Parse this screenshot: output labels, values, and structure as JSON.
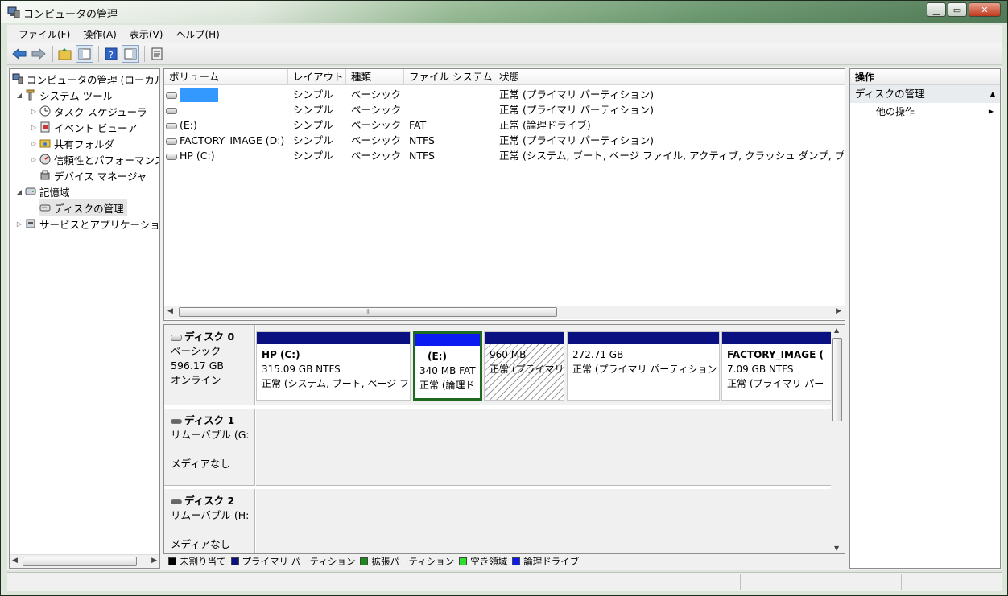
{
  "window": {
    "title": "コンピュータの管理"
  },
  "menu": [
    "ファイル(F)",
    "操作(A)",
    "表示(V)",
    "ヘルプ(H)"
  ],
  "tree": {
    "items": [
      {
        "label": "コンピュータの管理 (ローカル",
        "level": 0,
        "expander": ""
      },
      {
        "label": "システム ツール",
        "level": 1,
        "expander": "◢"
      },
      {
        "label": "タスク スケジューラ",
        "level": 2,
        "expander": "▷"
      },
      {
        "label": "イベント ビューア",
        "level": 2,
        "expander": "▷"
      },
      {
        "label": "共有フォルダ",
        "level": 2,
        "expander": "▷"
      },
      {
        "label": "信頼性とパフォーマンス",
        "level": 2,
        "expander": "▷"
      },
      {
        "label": "デバイス マネージャ",
        "level": 2,
        "expander": ""
      },
      {
        "label": "記憶域",
        "level": 1,
        "expander": "◢"
      },
      {
        "label": "ディスクの管理",
        "level": 2,
        "expander": ""
      },
      {
        "label": "サービスとアプリケーション",
        "level": 1,
        "expander": "▷"
      }
    ]
  },
  "volumes": {
    "columns": [
      "ボリューム",
      "レイアウト",
      "種類",
      "ファイル システム",
      "状態"
    ],
    "rows": [
      {
        "name": "",
        "layout": "シンプル",
        "type": "ベーシック",
        "fs": "",
        "status": "正常 (プライマリ パーティション)"
      },
      {
        "name": "",
        "layout": "シンプル",
        "type": "ベーシック",
        "fs": "",
        "status": "正常 (プライマリ パーティション)"
      },
      {
        "name": "(E:)",
        "layout": "シンプル",
        "type": "ベーシック",
        "fs": "FAT",
        "status": "正常 (論理ドライブ)"
      },
      {
        "name": "FACTORY_IMAGE (D:)",
        "layout": "シンプル",
        "type": "ベーシック",
        "fs": "NTFS",
        "status": "正常 (プライマリ パーティション)"
      },
      {
        "name": "HP (C:)",
        "layout": "シンプル",
        "type": "ベーシック",
        "fs": "NTFS",
        "status": "正常 (システム, ブート, ページ ファイル, アクティブ, クラッシュ ダンプ, プラ"
      }
    ],
    "scroll_thumb": "III"
  },
  "disks": [
    {
      "title": "ディスク 0",
      "line1": "ベーシック",
      "line2": "596.17 GB",
      "line3": "オンライン",
      "partitions": [
        {
          "name": "HP  (C:)",
          "size": "315.09 GB NTFS",
          "status": "正常 (システム, ブート, ページ フ"
        },
        {
          "name": "(E:)",
          "size": "340 MB FAT",
          "status": "正常 (論理ド"
        },
        {
          "name": "",
          "size": "960 MB",
          "status": "正常 (プライマリ"
        },
        {
          "name": "",
          "size": "272.71 GB",
          "status": "正常 (プライマリ パーティション"
        },
        {
          "name": "FACTORY_IMAGE  (",
          "size": "7.09 GB NTFS",
          "status": "正常 (プライマリ パー"
        }
      ]
    },
    {
      "title": "ディスク 1",
      "line1": "リムーバブル (G:",
      "line2": "",
      "line3": "メディアなし"
    },
    {
      "title": "ディスク 2",
      "line1": "リムーバブル (H:",
      "line2": "",
      "line3": "メディアなし"
    }
  ],
  "legend": [
    {
      "label": "未割り当て",
      "color": "#000000"
    },
    {
      "label": "プライマリ パーティション",
      "color": "#0a1080"
    },
    {
      "label": "拡張パーティション",
      "color": "#1a8a1a"
    },
    {
      "label": "空き領域",
      "color": "#2ee02e"
    },
    {
      "label": "論理ドライブ",
      "color": "#0b1af0"
    }
  ],
  "actions": {
    "header": "操作",
    "group": "ディスクの管理",
    "item": "他の操作"
  }
}
